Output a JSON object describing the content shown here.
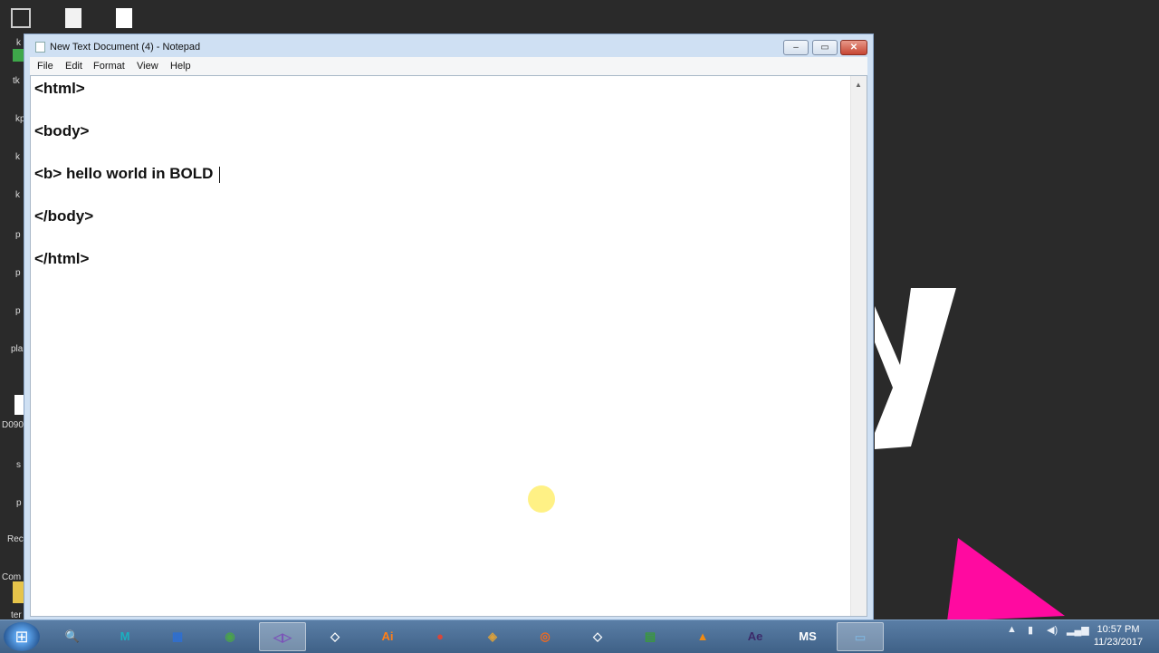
{
  "desktop": {
    "icon_labels": [
      "k",
      "tk",
      "kp",
      "k",
      "k",
      "p",
      "p",
      "p",
      "pla",
      "D090",
      "s",
      "p",
      "Rec",
      "Com",
      "ter"
    ]
  },
  "window": {
    "title": "New Text Document (4) - Notepad",
    "min_glyph": "–",
    "max_glyph": "▭",
    "close_glyph": "✕"
  },
  "menu": {
    "file": "File",
    "edit": "Edit",
    "format": "Format",
    "view": "View",
    "help": "Help"
  },
  "editor": {
    "lines": [
      "<html>",
      "",
      "<body>",
      "",
      "<b> hello world in BOLD",
      "",
      "</body>",
      "",
      "</html>"
    ]
  },
  "taskbar": {
    "apps": [
      {
        "name": "search-app",
        "glyph": "🔍",
        "color": "#f0a040"
      },
      {
        "name": "maya-app",
        "glyph": "M",
        "color": "#1ab0c0"
      },
      {
        "name": "spreadsheet-app",
        "glyph": "▦",
        "color": "#2f6fd0"
      },
      {
        "name": "network-app",
        "glyph": "◉",
        "color": "#4aa34a"
      },
      {
        "name": "visual-studio-app",
        "glyph": "◁▷",
        "color": "#7b55b8"
      },
      {
        "name": "unity-app",
        "glyph": "◇",
        "color": "#222"
      },
      {
        "name": "illustrator-app",
        "glyph": "Ai",
        "color": "#ff7f18"
      },
      {
        "name": "chrome-app",
        "glyph": "●",
        "color": "#d8463a"
      },
      {
        "name": "shield-app",
        "glyph": "◈",
        "color": "#d9a03c"
      },
      {
        "name": "camera-app",
        "glyph": "◎",
        "color": "#f06a1f"
      },
      {
        "name": "unity-app-2",
        "glyph": "◇",
        "color": "#222"
      },
      {
        "name": "chart-app",
        "glyph": "▤",
        "color": "#3a9a3a"
      },
      {
        "name": "vlc-app",
        "glyph": "▲",
        "color": "#f08a12"
      },
      {
        "name": "after-effects-app",
        "glyph": "Ae",
        "color": "#3c2a6a"
      },
      {
        "name": "ms-app",
        "glyph": "MS",
        "color": "#444"
      },
      {
        "name": "notepad-app",
        "glyph": "▭",
        "color": "#7fb0d8"
      }
    ],
    "clock_time": "10:57 PM",
    "clock_date": "11/23/2017"
  }
}
